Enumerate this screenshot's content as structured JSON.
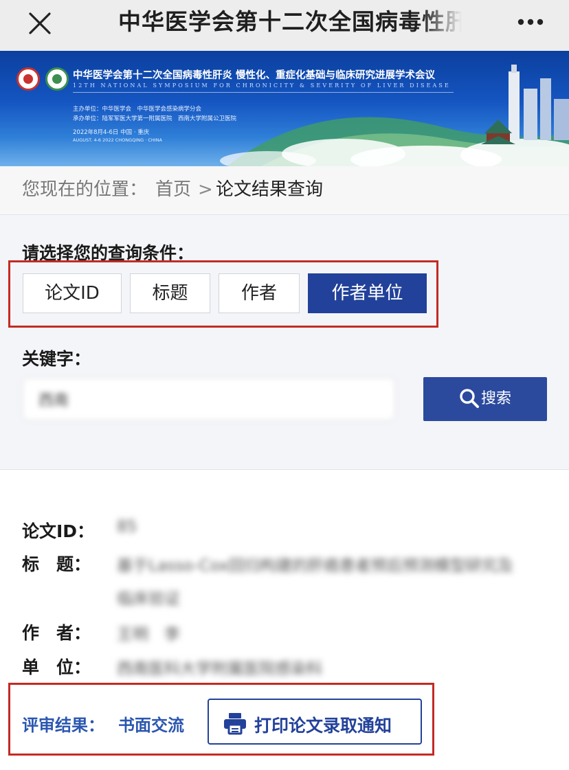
{
  "topbar": {
    "title": "中华医学会第十二次全国病毒性肝炎"
  },
  "banner": {
    "title": "中华医学会第十二次全国病毒性肝炎 慢性化、重症化基础与临床研究进展学术会议",
    "subtitle": "12TH NATIONAL SYMPOSIUM FOR CHRONICITY & SEVERITY OF LIVER DISEASE",
    "host": "主办单位：中华医学会　中华医学会感染病学分会",
    "organizer": "承办单位：陆军军医大学第一附属医院　西南大学附属公卫医院",
    "date": "2022年8月4-6日 中国 · 重庆",
    "date_en": "AUGUST. 4-6 2022 CHONGQING · CHINA"
  },
  "breadcrumb": {
    "prefix": "您现在的位置：",
    "home": "首页",
    "separator": ">",
    "current": "论文结果查询"
  },
  "query": {
    "label": "请选择您的查询条件：",
    "options": [
      "论文ID",
      "标题",
      "作者",
      "作者单位"
    ],
    "selected": "作者单位",
    "keyword_label": "关键字：",
    "search_value": "西南",
    "search_button": "搜索"
  },
  "result": {
    "id_label": "论文ID：",
    "id_value": "85",
    "title_label": "标　题：",
    "title_value_line1": "基于Lasso-Cox回归构建的肝癌患者预后预测模型研究及",
    "title_value_line2": "临床验证",
    "author_label": "作　者：",
    "author_value": "王明　李",
    "unit_label": "单　位：",
    "unit_value": "西南医科大学附属医院感染科",
    "review_label": "评审结果：",
    "review_value": "书面交流",
    "print_button": "打印论文录取通知"
  },
  "colors": {
    "primary": "#22419a",
    "highlight_box": "#c42a24",
    "review_text": "#2a56b0"
  }
}
